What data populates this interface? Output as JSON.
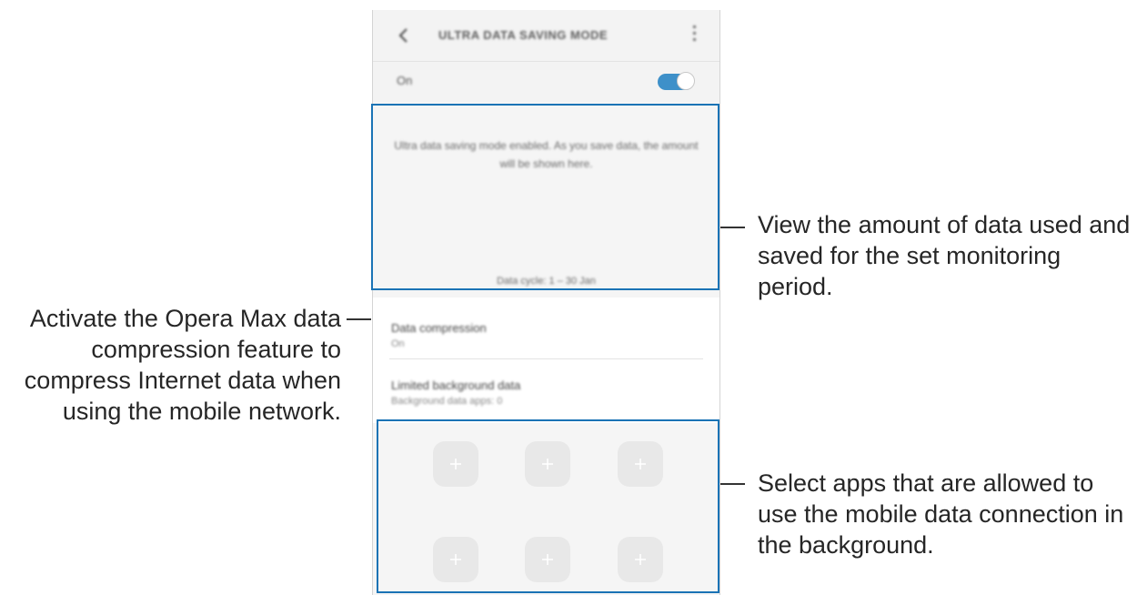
{
  "phone": {
    "header": {
      "title": "ULTRA DATA SAVING MODE",
      "back_icon": "chevron-left-icon",
      "more_icon": "more-vertical-icon"
    },
    "master_switch": {
      "label": "On",
      "state": "on",
      "accent_color": "#3e90c9"
    },
    "savings_info": {
      "message": "Ultra data saving mode enabled. As you save data, the amount will be shown here.",
      "cycle_label": "Data cycle: 1 – 30 Jan"
    },
    "settings": [
      {
        "title": "Data compression",
        "subtitle": "On"
      },
      {
        "title": "Limited background data",
        "subtitle": "Background data apps: 0"
      }
    ],
    "app_slots": [
      {
        "icon": "plus-icon"
      },
      {
        "icon": "plus-icon"
      },
      {
        "icon": "plus-icon"
      },
      {
        "icon": "plus-icon"
      },
      {
        "icon": "plus-icon"
      },
      {
        "icon": "plus-icon"
      }
    ]
  },
  "callouts": {
    "savings": "View the amount of data used and saved for the set monitoring period.",
    "compression": "Activate the Opera Max data compression feature to compress Internet data when using the mobile network.",
    "apps": "Select apps that are allowed to use the mobile data connection in the background."
  },
  "colors": {
    "highlight_border": "#1a73b5"
  }
}
